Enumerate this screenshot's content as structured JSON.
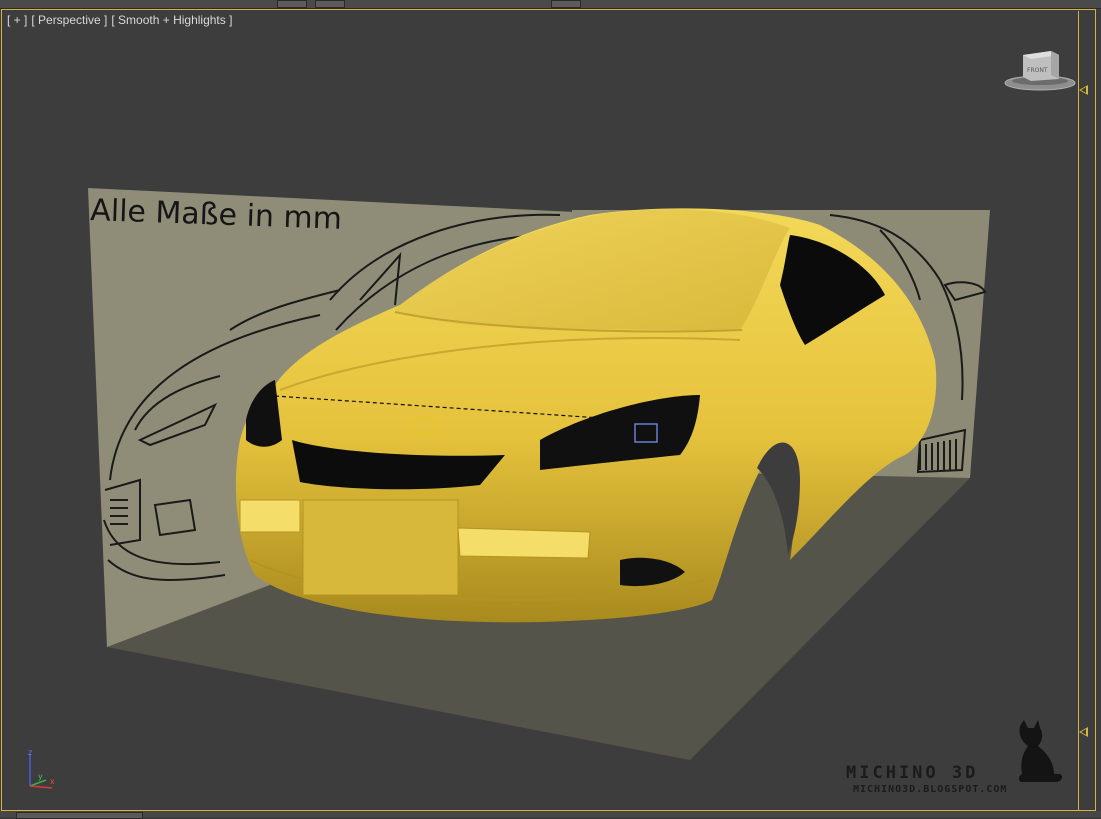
{
  "viewport": {
    "label_plus": "[ + ]",
    "label_view": "[ Perspective ]",
    "label_shading": "[ Smooth + Highlights ]"
  },
  "blueprint": {
    "caption": "Alle Maße in mm"
  },
  "viewcube": {
    "face_label": "FRONT"
  },
  "axis_gizmo": {
    "z_label": "z",
    "y_label": "y",
    "x_label": "x"
  },
  "watermark": {
    "title": "MICHINO 3D",
    "url": "MICHINO3D.BLOGSPOT.COM"
  },
  "colors": {
    "viewport_border": "#d6b444",
    "background": "#3d3d3d",
    "car_body": "#e8c640",
    "floor_plane": "#55544a",
    "blueprint_plane": "#8d8b76"
  },
  "icons": {
    "viewcube": "viewcube-icon",
    "axis": "axis-tripod-icon",
    "cat": "cat-silhouette-icon",
    "markers": "triangle-marker-icon"
  }
}
